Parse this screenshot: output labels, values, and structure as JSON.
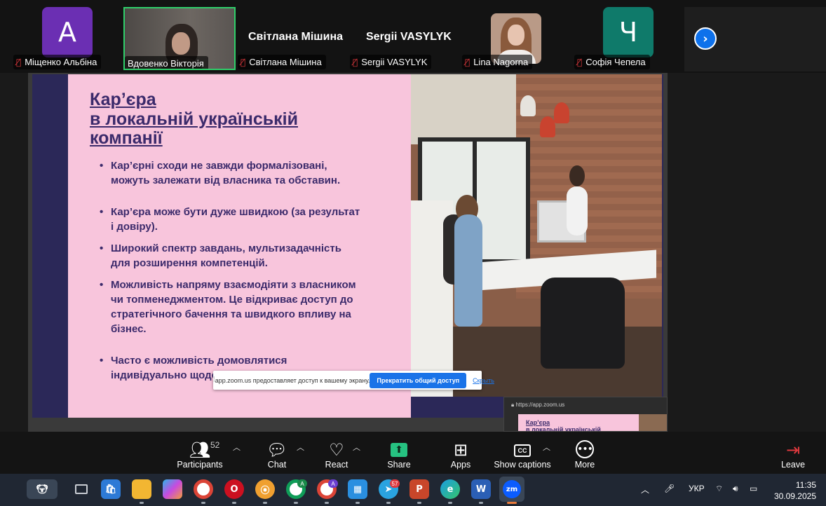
{
  "participants": [
    {
      "initial": "A",
      "avatar_color": "#6b2fb3",
      "name": "Міщенко Альбіна",
      "muted": true
    },
    {
      "name": "Вдовенко Вікторія",
      "muted": false,
      "speaking": true
    },
    {
      "display_name": "Світлана Мішина",
      "name": "Світлана Мішина",
      "muted": true
    },
    {
      "display_name": "Sergii VASYLYK",
      "name": "Sergii VASYLYK",
      "muted": true
    },
    {
      "name": "Lina Nagorna",
      "muted": true
    },
    {
      "initial": "Ч",
      "avatar_color": "#0f7a6a",
      "name": "Софія Чепела",
      "muted": true
    }
  ],
  "slide": {
    "title": "Кар’єра \nв локальній українській\nкомпанії",
    "bullets": [
      "Кар’єрні сходи не завжди формалізовані, можуть залежати від власника та обставин.",
      "Кар’єра може бути дуже швидкою (за результат і довіру).",
      "Широкий спектр завдань, мультизадачність для розширення компетенцій.",
      "Можливість напряму взаємодіяти з власником чи топменеджментом. Це відкриває доступ до стратегічного бачення та швидкого впливу на бізнес.",
      "Часто є можливість домовлятися індивідуально щодо графіку."
    ],
    "colors": {
      "pink": "#f8c5dc",
      "navy": "#2b2858",
      "text": "#3b2a6b"
    }
  },
  "share_notification": {
    "message": "app.zoom.us предоставляет доступ к вашему экрану.",
    "stop_button": "Прекратить общий доступ",
    "hide_link": "Скрыть"
  },
  "preview": {
    "url": "https://app.zoom.us",
    "title": "Кар’єра\nв локальній українській"
  },
  "toolbar": {
    "participants_label": "Participants",
    "participants_count": "52",
    "chat_label": "Chat",
    "react_label": "React",
    "share_label": "Share",
    "apps_label": "Apps",
    "captions_label": "Show captions",
    "more_label": "More",
    "leave_label": "Leave",
    "cc_text": "CC"
  },
  "taskbar": {
    "telegram_badge": "57",
    "chrome_badge_1": "A",
    "chrome_badge_2": "A",
    "language": "УКР",
    "time": "11:35",
    "date": "30.09.2025"
  }
}
